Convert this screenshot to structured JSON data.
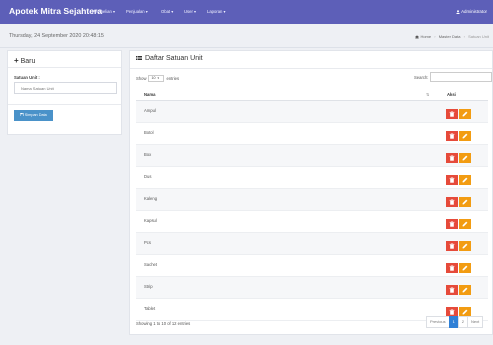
{
  "navbar": {
    "brand": "Apotek Mitra Sejahtera",
    "menu": [
      {
        "label": "Pembelian ▾"
      },
      {
        "label": "Penjualan ▾"
      },
      {
        "label": "Obat ▾"
      },
      {
        "label": "User ▾"
      },
      {
        "label": "Laporan ▾"
      }
    ],
    "user": "Administrator"
  },
  "subbar": {
    "date": "Thursday, 24 September 2020 20:48:15",
    "breadcrumb": [
      "Home",
      "Master Data",
      "Satuan Unit"
    ]
  },
  "form": {
    "title": "Baru",
    "label": "Satuan Unit :",
    "placeholder": "Nama Satuan Unit",
    "save_label": "Simpan Data"
  },
  "table": {
    "title": "Daftar Satuan Unit",
    "show_label": "Show",
    "entries_value": "10",
    "entries_label": "entries",
    "search_label": "Search:",
    "columns": [
      "Nama",
      "Aksi"
    ],
    "rows": [
      "Ampul",
      "Botol",
      "Box",
      "Dus",
      "Kaleng",
      "Kapsul",
      "Pcs",
      "Sachet",
      "Strip",
      "Tablet"
    ],
    "info": "Showing 1 to 10 of 12 entries",
    "pagination": {
      "previous": "Previous",
      "pages": [
        "1",
        "2"
      ],
      "current": "1",
      "next": "Next"
    }
  },
  "colors": {
    "navbar": "#5d5fb8",
    "delete": "#e64a3a",
    "edit": "#f29c12",
    "primary": "#4a92c9",
    "page_active": "#2f80d6"
  }
}
